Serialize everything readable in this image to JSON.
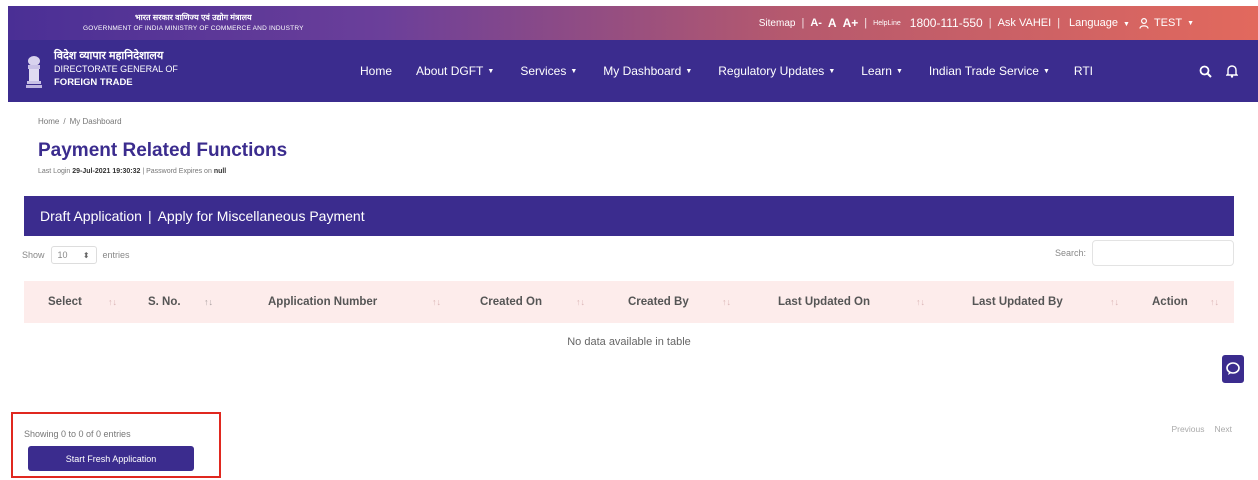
{
  "header": {
    "gov_line_hi": "भारत सरकार  वाणिज्य एवं उद्योग मंत्रालय",
    "gov_line_en": "GOVERNMENT OF INDIA  MINISTRY OF COMMERCE AND INDUSTRY",
    "sitemap": "Sitemap",
    "font_small": "A-",
    "font_normal": "A",
    "font_large": "A+",
    "helpline_label": "HelpLine",
    "helpline_number": "1800-111-550",
    "ask": "Ask VAHEI",
    "language": "Language",
    "user": "TEST"
  },
  "brand": {
    "hindi": "विदेश व्यापार महानिदेशालय",
    "line1": "DIRECTORATE GENERAL OF",
    "line2": "FOREIGN TRADE"
  },
  "nav": {
    "home": "Home",
    "about": "About DGFT",
    "services": "Services",
    "dashboard": "My Dashboard",
    "regulatory": "Regulatory Updates",
    "learn": "Learn",
    "its": "Indian Trade Service",
    "rti": "RTI"
  },
  "breadcrumb": {
    "home": "Home",
    "current": "My Dashboard"
  },
  "page": {
    "title": "Payment Related Functions",
    "last_login_label": "Last Login",
    "last_login_value": "29-Jul-2021 19:30:32",
    "password_label": "Password Expires on",
    "password_value": "null"
  },
  "panel": {
    "draft": "Draft Application",
    "misc": "Apply for Miscellaneous Payment"
  },
  "table": {
    "show_label": "Show",
    "length_value": "10",
    "entries_label": "entries",
    "search_label": "Search:",
    "columns": [
      "Select",
      "S. No.",
      "Application Number",
      "Created On",
      "Created By",
      "Last Updated On",
      "Last Updated By",
      "Action"
    ],
    "empty_text": "No data available in table",
    "info": "Showing 0 to 0 of 0 entries",
    "previous": "Previous",
    "next": "Next"
  },
  "actions": {
    "start_fresh": "Start Fresh Application"
  },
  "colors": {
    "brand_purple": "#3b2c8e",
    "header_gradient_end": "#e2695d",
    "table_header_bg": "#fdeceb",
    "highlight_red": "#e0281f"
  }
}
